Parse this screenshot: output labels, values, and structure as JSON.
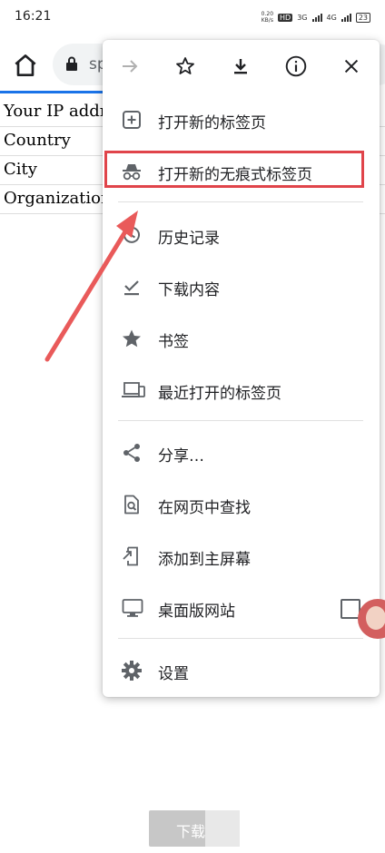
{
  "status_bar": {
    "time": "16:21",
    "speed_top": "0.20",
    "speed_bottom": "KB/s",
    "hd_badge": "HD",
    "network_a": "3G",
    "network_b": "4G",
    "battery": "23"
  },
  "toolbar": {
    "url_visible": "sp"
  },
  "page": {
    "rows": [
      "Your IP addr",
      "Country",
      "City",
      "Organization"
    ]
  },
  "menu": {
    "top_icons": [
      "forward-icon",
      "star-icon",
      "download-icon",
      "info-icon",
      "close-icon"
    ],
    "items": [
      {
        "label": "打开新的标签页",
        "icon": "new-tab-icon"
      },
      {
        "label": "打开新的无痕式标签页",
        "icon": "incognito-icon"
      },
      {
        "label": "历史记录",
        "icon": "history-icon"
      },
      {
        "label": "下载内容",
        "icon": "downloads-icon"
      },
      {
        "label": "书签",
        "icon": "bookmarks-icon"
      },
      {
        "label": "最近打开的标签页",
        "icon": "recent-tabs-icon"
      },
      {
        "label": "分享…",
        "icon": "share-icon"
      },
      {
        "label": "在网页中查找",
        "icon": "find-in-page-icon"
      },
      {
        "label": "添加到主屏幕",
        "icon": "add-to-homescreen-icon"
      },
      {
        "label": "桌面版网站",
        "icon": "desktop-site-icon",
        "checked": false
      },
      {
        "label": "设置",
        "icon": "settings-icon"
      }
    ]
  },
  "bottom": {
    "download_label": "下载"
  },
  "colors": {
    "highlight": "#e0444a",
    "progress": "#1a73e8",
    "icon": "#5f6368"
  }
}
